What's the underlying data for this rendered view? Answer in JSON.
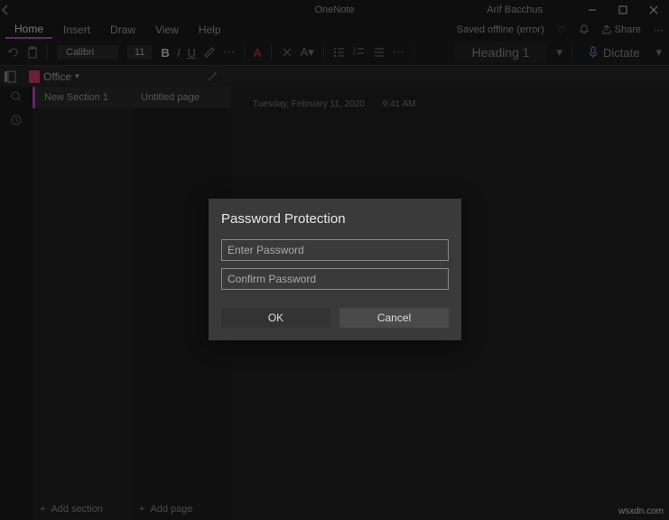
{
  "titlebar": {
    "app_name": "OneNote",
    "user_name": "Arif Bacchus"
  },
  "tabs": {
    "items": [
      "Home",
      "Insert",
      "Draw",
      "View",
      "Help"
    ],
    "active_index": 0,
    "status": "Saved offline (error)",
    "share_label": "Share"
  },
  "toolbar": {
    "font_name": "Calibri",
    "font_size": "11",
    "style_label": "Heading 1",
    "dictate_label": "Dictate"
  },
  "notebook": {
    "name": "Office"
  },
  "sections": {
    "items": [
      "New Section 1"
    ],
    "add_label": "Add section"
  },
  "pages": {
    "items": [
      "Untitled page"
    ],
    "add_label": "Add page"
  },
  "canvas": {
    "date": "Tuesday, February 11, 2020",
    "time": "9:41 AM"
  },
  "dialog": {
    "title": "Password Protection",
    "enter_placeholder": "Enter Password",
    "confirm_placeholder": "Confirm Password",
    "ok_label": "OK",
    "cancel_label": "Cancel"
  },
  "watermark": "wsxdn.com"
}
